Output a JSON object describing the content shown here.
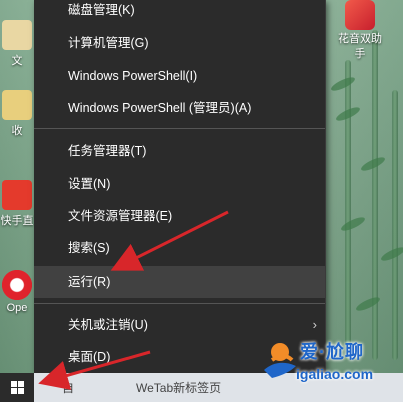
{
  "menu": {
    "items": [
      {
        "label": "磁盘管理(K)"
      },
      {
        "label": "计算机管理(G)"
      },
      {
        "label": "Windows PowerShell(I)"
      },
      {
        "label": "Windows PowerShell (管理员)(A)"
      },
      {
        "label": "任务管理器(T)"
      },
      {
        "label": "设置(N)"
      },
      {
        "label": "文件资源管理器(E)"
      },
      {
        "label": "搜索(S)"
      },
      {
        "label": "运行(R)"
      },
      {
        "label": "关机或注销(U)"
      },
      {
        "label": "桌面(D)"
      }
    ],
    "highlighted_item": "运行(R)"
  },
  "desktop_icons_left": [
    {
      "label": "文"
    },
    {
      "label": "收"
    },
    {
      "label": "快手直"
    },
    {
      "label": "Ope"
    }
  ],
  "desktop_icon_right": {
    "label_line1": "花音双助",
    "label_line2": "手"
  },
  "taskbar": {
    "item_text_1": "自",
    "item_text_2": "WeTab新标签页"
  },
  "watermark": {
    "title": "爱·尬聊",
    "url": "igaliao.com"
  },
  "colors": {
    "menu_bg": "#2b2b2b",
    "menu_highlight": "#414141",
    "arrow": "#d8262a",
    "watermark": "#1f66c9"
  }
}
